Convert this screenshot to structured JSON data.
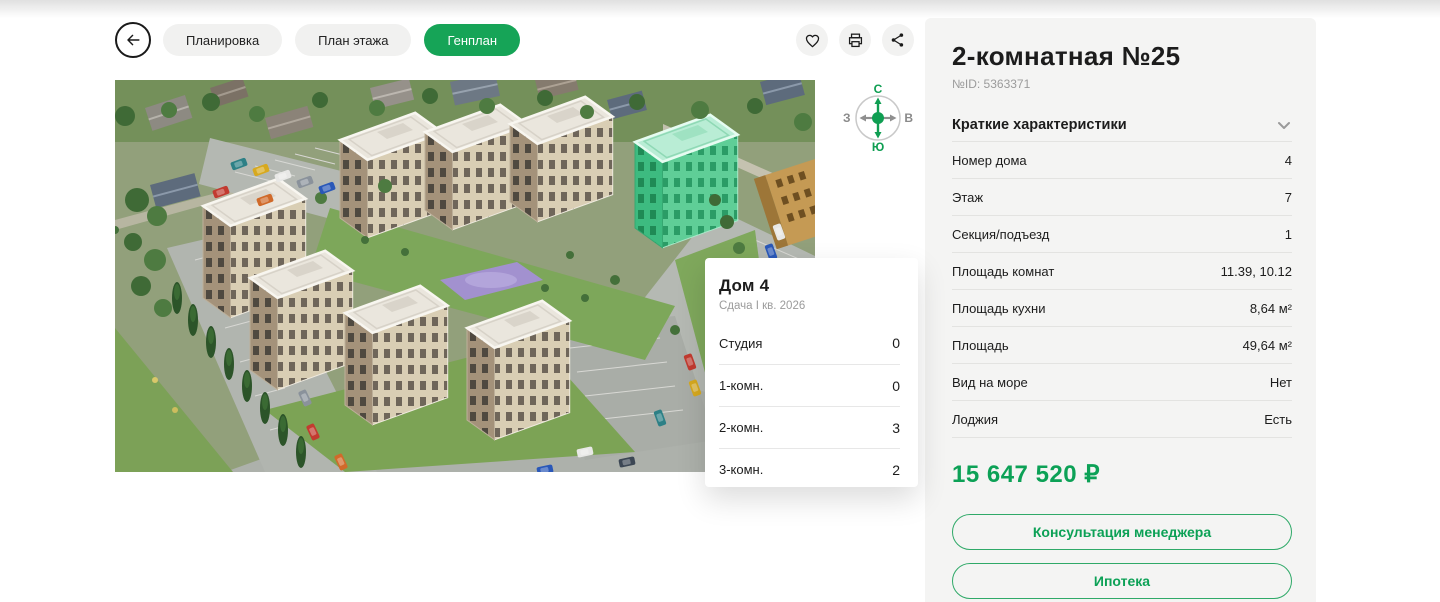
{
  "colors": {
    "accent_green": "#16a457",
    "price_green": "#0ca156",
    "highlight_building": "#57c893",
    "panel_bg": "#f4f4f3"
  },
  "header": {
    "tabs": [
      {
        "label": "Планировка",
        "active": false
      },
      {
        "label": "План этажа",
        "active": false
      },
      {
        "label": "Генплан",
        "active": true
      }
    ],
    "icons": [
      "back-arrow",
      "heart",
      "printer",
      "share"
    ]
  },
  "compass": {
    "north": "С",
    "south": "Ю",
    "west": "З",
    "east": "В"
  },
  "tooltip": {
    "title": "Дом 4",
    "subtitle": "Сдача I кв. 2026",
    "rows": [
      {
        "label": "Студия",
        "value": "0"
      },
      {
        "label": "1-комн.",
        "value": "0"
      },
      {
        "label": "2-комн.",
        "value": "3"
      },
      {
        "label": "3-комн.",
        "value": "2"
      }
    ]
  },
  "panel": {
    "title": "2-комнатная №25",
    "id": "№ID: 5363371",
    "section_title": "Краткие характеристики",
    "rows": [
      {
        "label": "Номер дома",
        "value": "4"
      },
      {
        "label": "Этаж",
        "value": "7"
      },
      {
        "label": "Секция/подъезд",
        "value": "1"
      },
      {
        "label": "Площадь комнат",
        "value": "11.39, 10.12"
      },
      {
        "label": "Площадь кухни",
        "value": "8,64 м²"
      },
      {
        "label": "Площадь",
        "value": "49,64 м²"
      },
      {
        "label": "Вид на море",
        "value": "Нет"
      },
      {
        "label": "Лоджия",
        "value": "Есть"
      }
    ],
    "price": "15 647 520 ₽",
    "buttons": [
      {
        "label": "Консультация менеджера"
      },
      {
        "label": "Ипотека"
      }
    ]
  }
}
